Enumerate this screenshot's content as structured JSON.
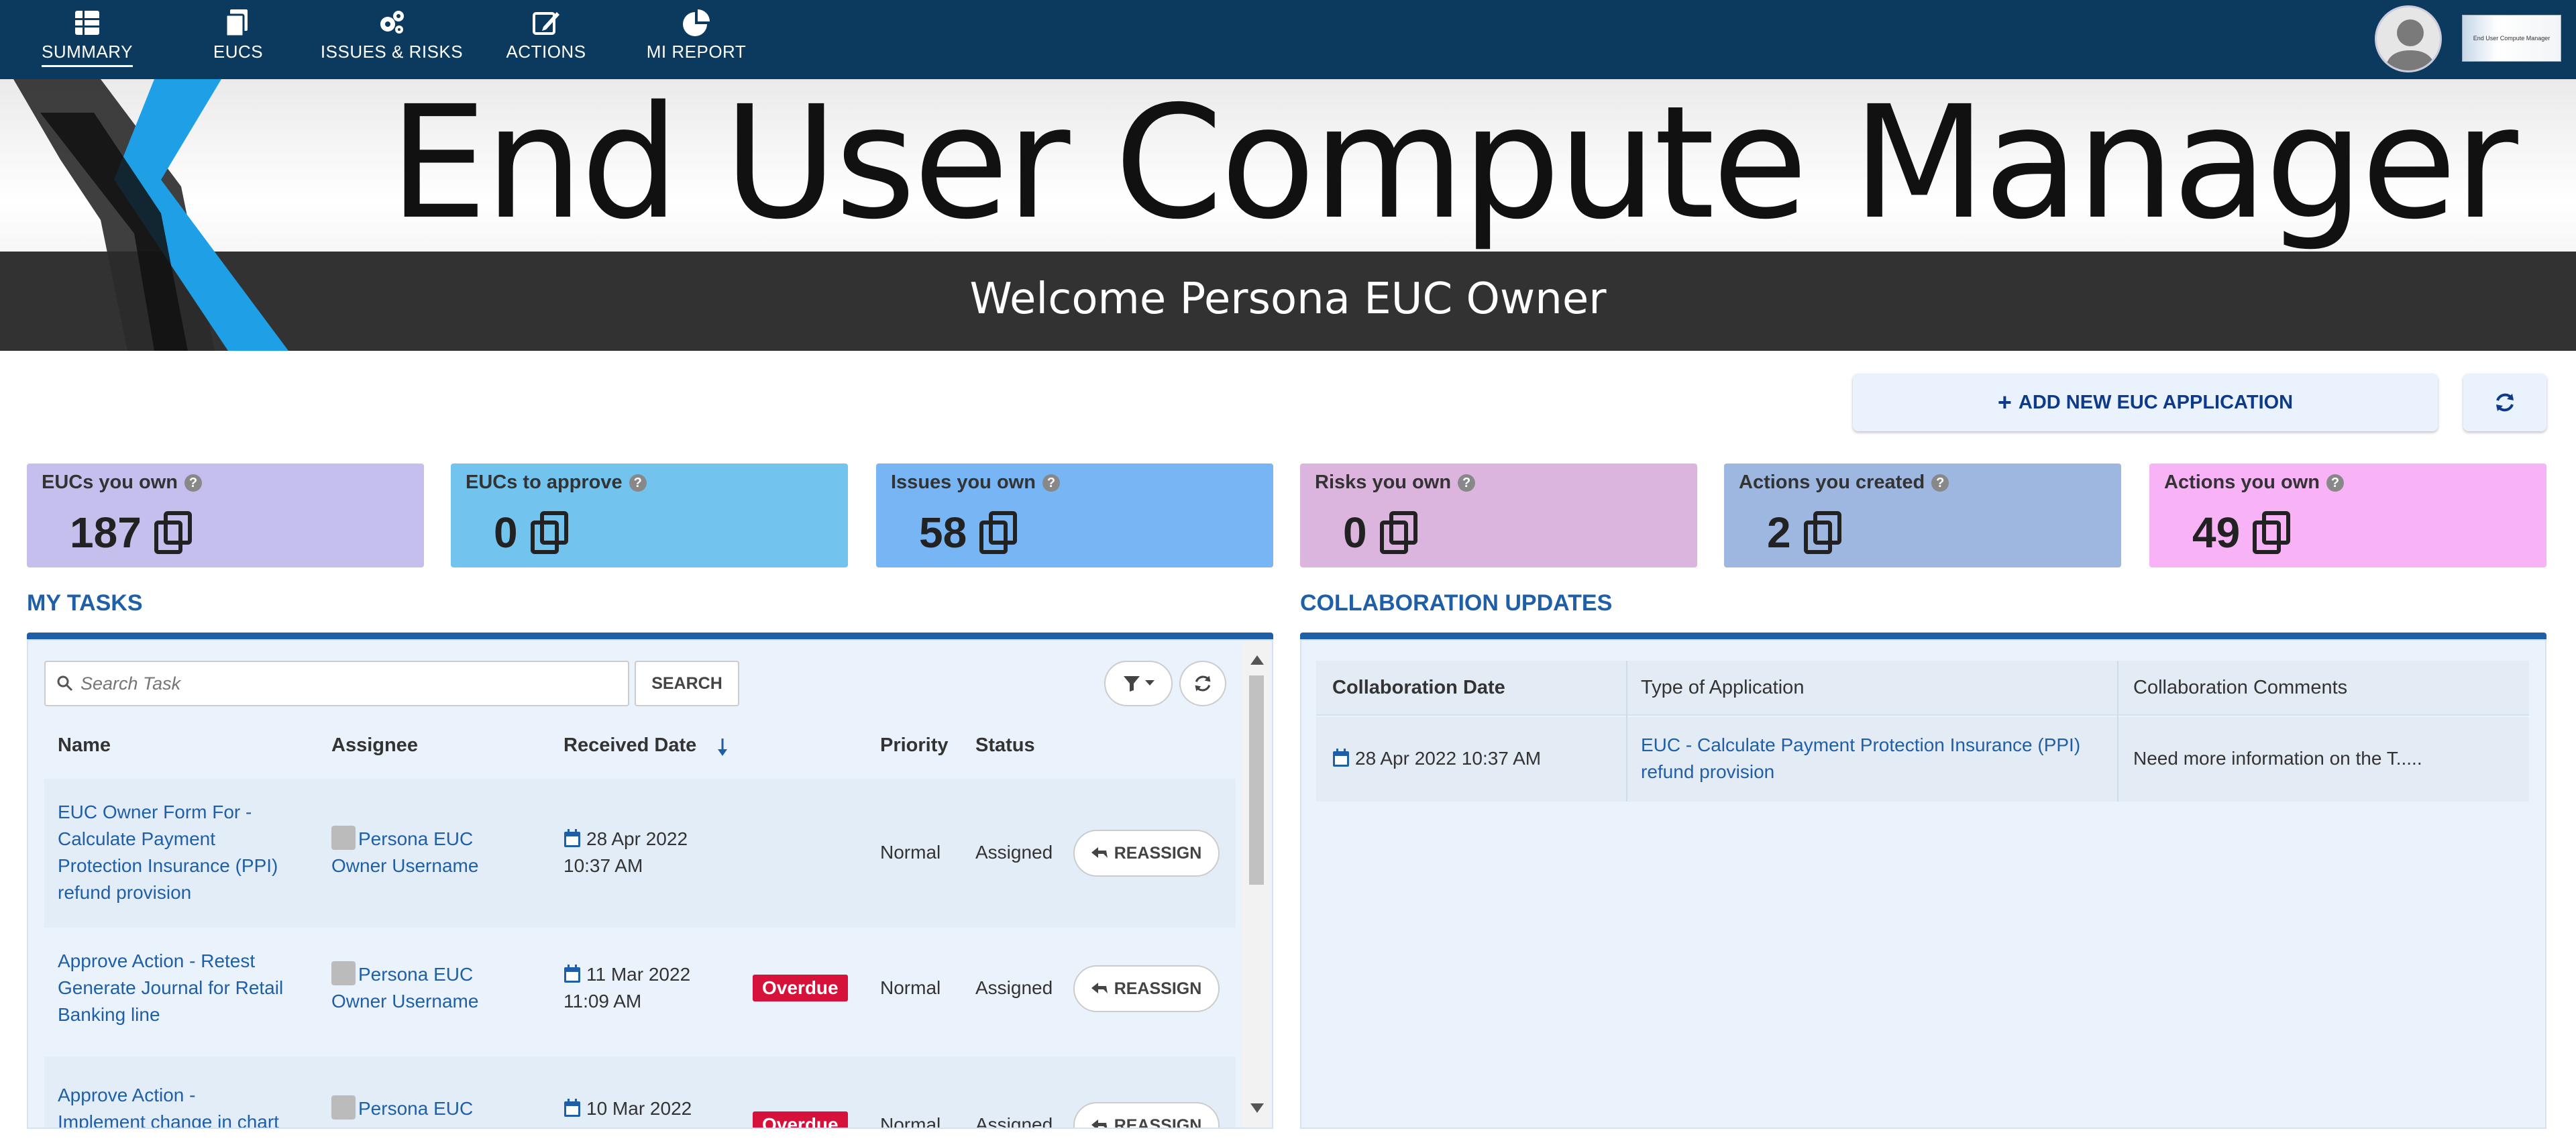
{
  "nav": {
    "items": [
      {
        "label": "SUMMARY",
        "icon": "table-icon"
      },
      {
        "label": "EUCS",
        "icon": "copy-icon"
      },
      {
        "label": "ISSUES & RISKS",
        "icon": "gears-icon"
      },
      {
        "label": "ACTIONS",
        "icon": "edit-icon"
      },
      {
        "label": "MI REPORT",
        "icon": "pie-chart-icon"
      }
    ],
    "active": "SUMMARY",
    "logo_text": "End User Compute Manager"
  },
  "banner": {
    "title": "End User Compute Manager",
    "welcome": "Welcome Persona EUC Owner"
  },
  "toolbar": {
    "add_label": "ADD NEW EUC APPLICATION"
  },
  "cards": [
    {
      "label": "EUCs you own",
      "value": "187",
      "color": "#c5bfee"
    },
    {
      "label": "EUCs to approve",
      "value": "0",
      "color": "#72c3ee"
    },
    {
      "label": "Issues you own",
      "value": "58",
      "color": "#77b5f4"
    },
    {
      "label": "Risks you own",
      "value": "0",
      "color": "#dcb5de"
    },
    {
      "label": "Actions you created",
      "value": "2",
      "color": "#9db7e0"
    },
    {
      "label": "Actions you own",
      "value": "49",
      "color": "#f8b3f6"
    }
  ],
  "tasks": {
    "title": "MY TASKS",
    "search_placeholder": "Search Task",
    "search_label": "SEARCH",
    "columns": {
      "name": "Name",
      "assignee": "Assignee",
      "received": "Received Date",
      "priority": "Priority",
      "status": "Status"
    },
    "rows": [
      {
        "name": "EUC Owner Form For - Calculate Payment Protection Insurance (PPI) refund provision",
        "name_lines": [
          "EUC Owner Form For -",
          "Calculate Payment",
          "Protection Insurance (PPI)",
          "refund provision"
        ],
        "assignee_lines": [
          "Persona EUC",
          "Owner Username"
        ],
        "date_lines": [
          "28 Apr 2022",
          "10:37 AM"
        ],
        "overdue": "",
        "priority": "Normal",
        "status": "Assigned",
        "action": "REASSIGN"
      },
      {
        "name": "Approve Action - Retest Generate Journal for Retail Banking line",
        "name_lines": [
          "Approve Action - Retest",
          "Generate Journal for Retail",
          "Banking line"
        ],
        "assignee_lines": [
          "Persona EUC",
          "Owner Username"
        ],
        "date_lines": [
          "11 Mar 2022",
          "11:09 AM"
        ],
        "overdue": "Overdue",
        "priority": "Normal",
        "status": "Assigned",
        "action": "REASSIGN"
      },
      {
        "name": "Approve Action - Implement change in chart",
        "name_lines": [
          "Approve Action -",
          "Implement change in chart"
        ],
        "assignee_lines": [
          "Persona EUC"
        ],
        "date_lines": [
          "10 Mar 2022"
        ],
        "overdue": "Overdue",
        "priority": "Normal",
        "status": "Assigned",
        "action": "REASSIGN"
      }
    ]
  },
  "collab": {
    "title": "COLLABORATION UPDATES",
    "columns": {
      "date": "Collaboration Date",
      "type": "Type of Application",
      "comments": "Collaboration Comments"
    },
    "rows": [
      {
        "date": "28 Apr 2022 10:37 AM",
        "type_lines": [
          "EUC - Calculate Payment Protection Insurance (PPI)",
          "refund provision"
        ],
        "comment": "Need more information on the T....."
      }
    ]
  },
  "colors": {
    "nav_bg": "#0c3a5e",
    "accent": "#1f5fa8",
    "overdue": "#d6113a"
  }
}
